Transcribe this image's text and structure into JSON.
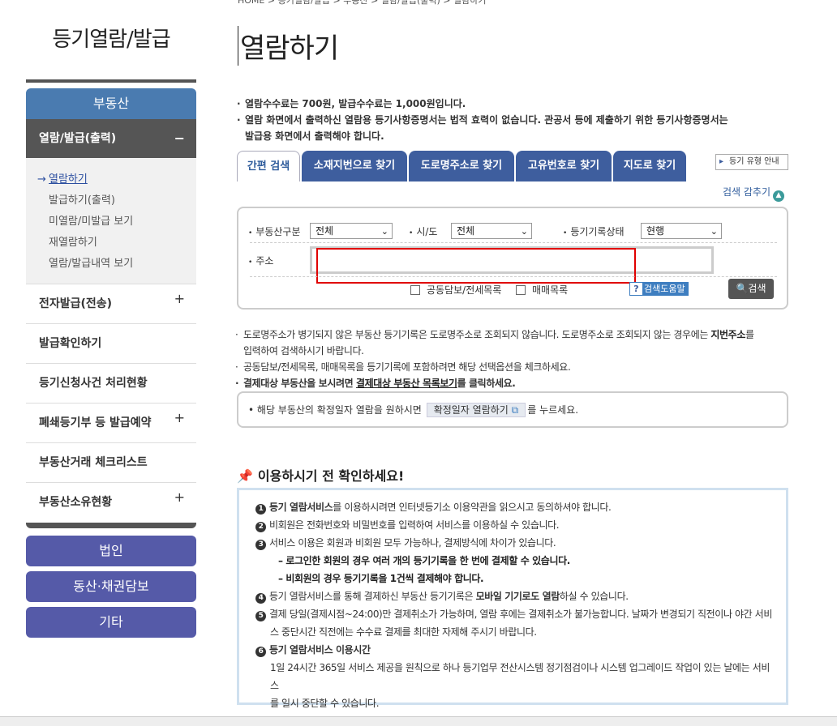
{
  "sidebar": {
    "title": "등기열람/발급",
    "header": "부동산",
    "sub_header": "열람/발급(출력)",
    "items": [
      "열람하기",
      "발급하기(출력)",
      "미열람/미발급 보기",
      "재열람하기",
      "열람/발급내역 보기"
    ],
    "menus": [
      "전자발급(전송)",
      "발급확인하기",
      "등기신청사건 처리현황",
      "폐쇄등기부 등 발급예약",
      "부동산거래 체크리스트",
      "부동산소유현황"
    ],
    "categories": [
      "법인",
      "동산·채권담보",
      "기타"
    ]
  },
  "main": {
    "breadcrumb": "HOME > 등기열람/발급 > 부동산 > 열람/발급(출력) > 열람하기",
    "title": "열람하기",
    "notes": [
      "열람수수료는 700원, 발급수수료는 1,000원입니다.",
      "열람 화면에서 출력하신 열람용 등기사항증명서는 법적 효력이 없습니다. 관공서 등에 제출하기 위한 등기사항증명서는",
      "발급용 화면에서 출력해야 합니다."
    ],
    "tabs": [
      "간편 검색",
      "소재지번으로 찾기",
      "도로명주소로 찾기",
      "고유번호로 찾기",
      "지도로 찾기"
    ],
    "guide_button": "등기 유형 안내",
    "collapse_label": "검색 감추기",
    "search": {
      "type_label": "부동산구분",
      "type_value": "전체",
      "sido_label": "시/도",
      "sido_value": "전체",
      "status_label": "등기기록상태",
      "status_value": "현행",
      "address_label": "주소",
      "address_value": "",
      "check1": "공동담보/전세목록",
      "check2": "매매목록",
      "help_label": "검색도움말",
      "search_label": "검색"
    },
    "tips": {
      "t1a": "도로명주소가 병기되지 않은 부동산 등기기록은 도로명주소로 조회되지 않습니다. 도로명주소로 조회되지 않는 경우에는 ",
      "t1b": "지번주소",
      "t1c": "를",
      "t1d": "입력하여 검색하시기 바랍니다.",
      "t2": "공동담보/전세목록, 매매목록을 등기기록에 포함하려면 해당 선택옵션을 체크하세요.",
      "t3a": "결제대상 부동산을 보시려면 ",
      "t3b": "결제대상 부동산 목록보기",
      "t3c": "를 클릭하세요."
    },
    "confirm": {
      "pre": "해당 부동산의 확정일자 열람을 원하시면",
      "button": "확정일자 열람하기",
      "post": "를 누르세요."
    },
    "check_title": "이용하시기 전 확인하세요!",
    "info": {
      "i1a": "등기 열람서비스",
      "i1b": "를 이용하시려면 인터넷등기소 이용약관을 읽으시고 동의하셔야 합니다.",
      "i2": "비회원은 전화번호와 비밀번호를 입력하여 서비스를 이용하실 수 있습니다.",
      "i3": "서비스 이용은 회원과 비회원 모두 가능하나, 결제방식에 차이가 있습니다.",
      "i3a": "– 로그인한 회원의 경우 여러 개의 등기기록을 한 번에 결제할 수 있습니다.",
      "i3b": "– 비회원의 경우 등기기록을 1건씩 결제해야 합니다.",
      "i4a": "등기 열람서비스를 통해 결제하신 부동산 등기기록은 ",
      "i4b": "모바일 기기로도 열람",
      "i4c": "하실 수 있습니다.",
      "i5a": "결제 당일(결제시점~24:00)만 결제취소가 가능하며, 열람 후에는 결제취소가 불가능합니다. 날짜가 변경되기 직전이나 야간 서비",
      "i5b": "스 중단시간 직전에는 수수료 결제를 최대한 자제해 주시기 바랍니다.",
      "i6": "등기 열람서비스 이용시간",
      "i6a": "1일 24시간 365일 서비스 제공을 원칙으로 하나 등기업무 전산시스템 정기점검이나 시스템 업그레이드 작업이 있는 날에는 서비스",
      "i6b": "를 일시 중단할 수 있습니다."
    }
  }
}
